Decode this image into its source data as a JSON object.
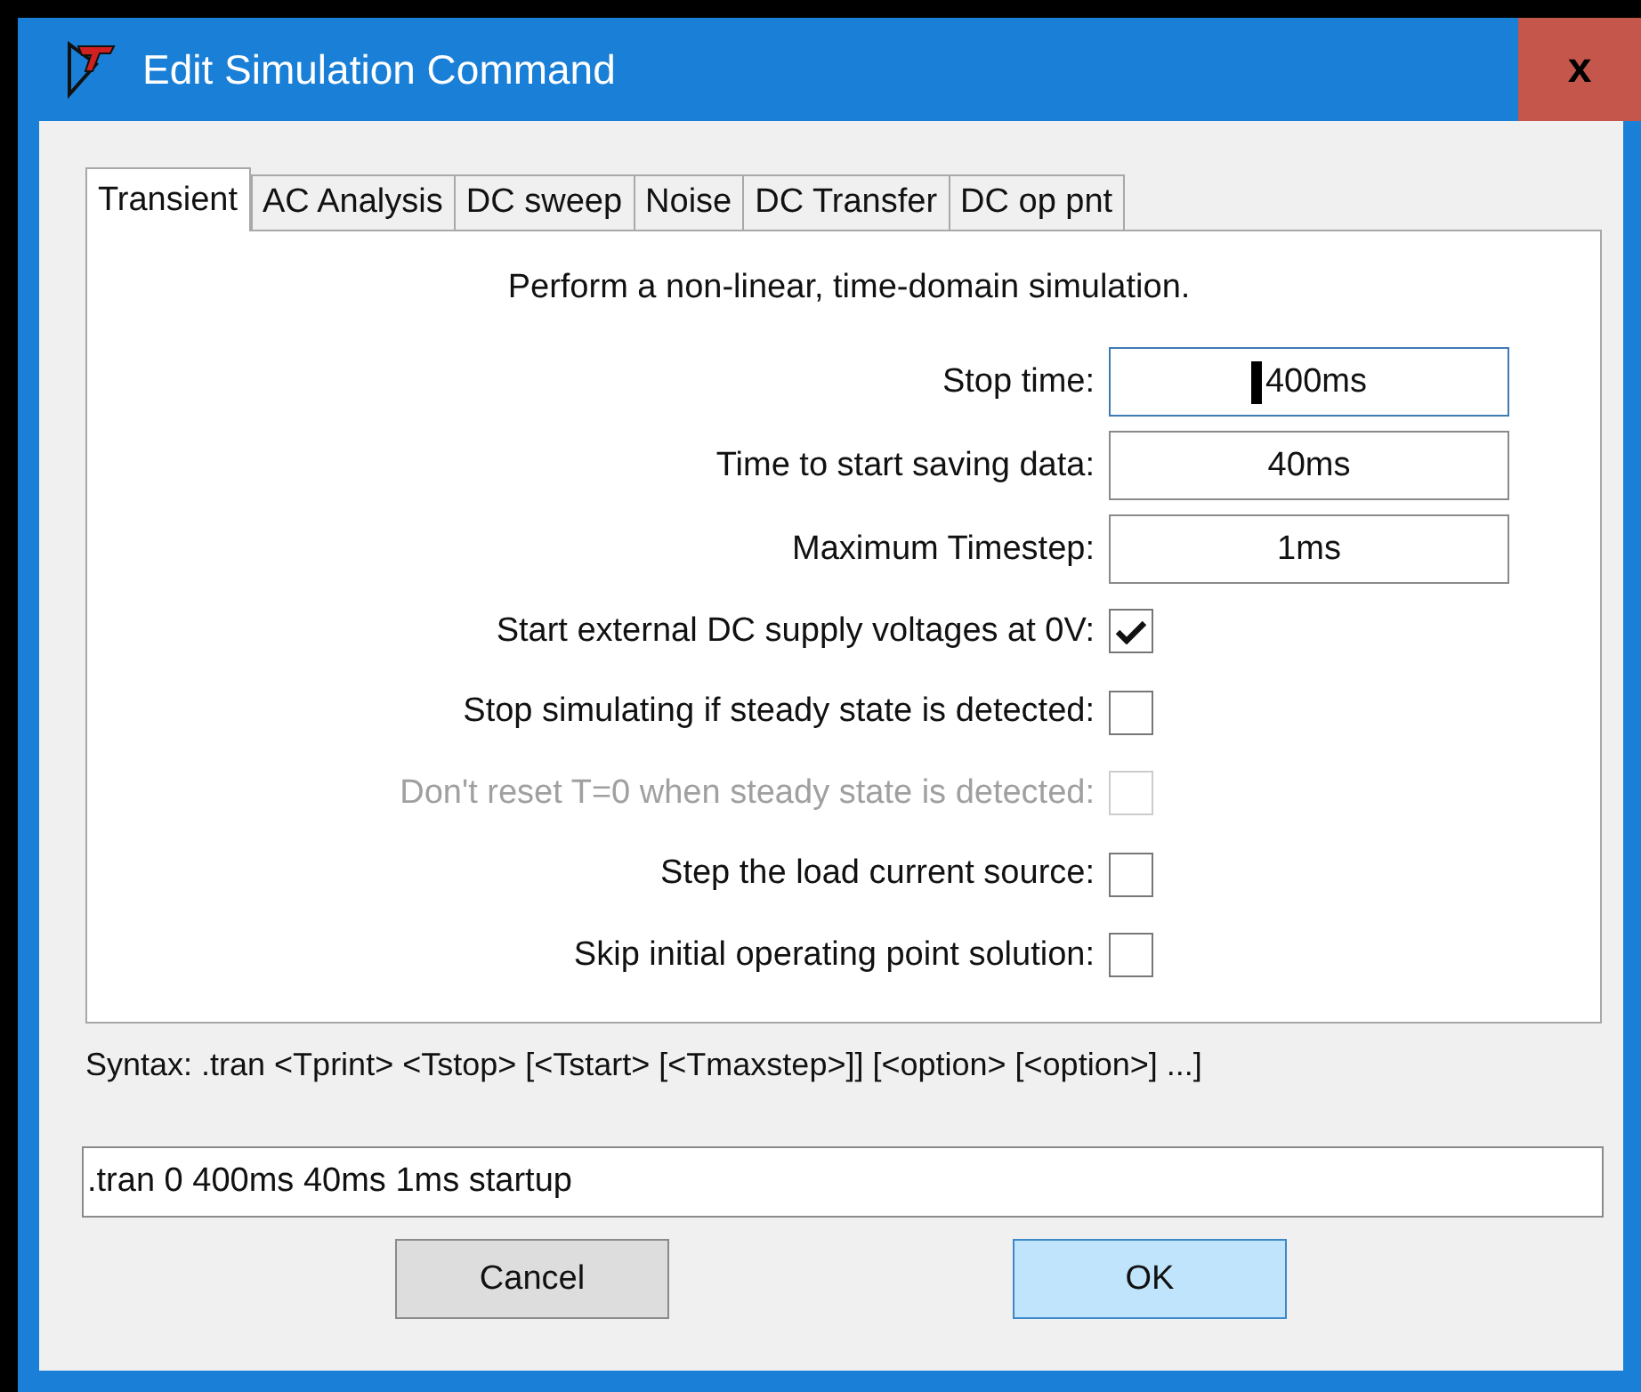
{
  "window": {
    "title": "Edit Simulation Command",
    "close": "x"
  },
  "tabs": [
    {
      "label": "Transient",
      "selected": true
    },
    {
      "label": "AC Analysis",
      "selected": false
    },
    {
      "label": "DC sweep",
      "selected": false
    },
    {
      "label": "Noise",
      "selected": false
    },
    {
      "label": "DC Transfer",
      "selected": false
    },
    {
      "label": "DC op pnt",
      "selected": false
    }
  ],
  "description": "Perform a non-linear, time-domain simulation.",
  "fields": [
    {
      "label": "Stop time:",
      "value": "400ms",
      "focused": true
    },
    {
      "label": "Time to start saving data:",
      "value": "40ms",
      "focused": false
    },
    {
      "label": "Maximum Timestep:",
      "value": "1ms",
      "focused": false
    }
  ],
  "checkboxes": [
    {
      "label": "Start external DC supply voltages at 0V:",
      "checked": true,
      "disabled": false
    },
    {
      "label": "Stop simulating if steady state is detected:",
      "checked": false,
      "disabled": false
    },
    {
      "label": "Don't reset T=0 when steady state is detected:",
      "checked": false,
      "disabled": true
    },
    {
      "label": "Step the load current source:",
      "checked": false,
      "disabled": false
    },
    {
      "label": "Skip initial operating point solution:",
      "checked": false,
      "disabled": false
    }
  ],
  "syntax": "Syntax:  .tran <Tprint> <Tstop> [<Tstart> [<Tmaxstep>]] [<option> [<option>] ...]",
  "command": ".tran 0 400ms 40ms 1ms startup",
  "buttons": [
    {
      "label": "Cancel",
      "kind": "cancel"
    },
    {
      "label": "OK",
      "kind": "default"
    }
  ]
}
